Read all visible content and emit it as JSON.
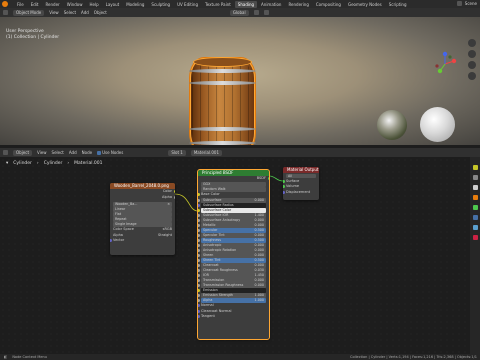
{
  "topbar": {
    "workspaces": [
      "File",
      "Edit",
      "Render",
      "Window",
      "Help",
      "Layout",
      "Modeling",
      "Sculpting",
      "UV Editing",
      "Texture Paint",
      "Shading",
      "Animation",
      "Rendering",
      "Compositing",
      "Geometry Nodes",
      "Scripting"
    ],
    "active_workspace": "Shading",
    "scene": "Scene"
  },
  "viewport": {
    "mode": "Object Mode",
    "menu": [
      "View",
      "Select",
      "Add",
      "Object"
    ],
    "transform": "Global",
    "info_line1": "User Perspective",
    "info_line2": "(1) Collection | Cylinder"
  },
  "node_editor": {
    "editor": "Object",
    "menu": [
      "View",
      "Select",
      "Add",
      "Node"
    ],
    "use_nodes_label": "Use Nodes",
    "slot": "Slot 1",
    "material": "Material.001",
    "breadcrumb": [
      "Cylinder",
      "Cylinder",
      "Material.001"
    ]
  },
  "image_node": {
    "title": "Wooden_Barrel_2048.0.png",
    "outputs": [
      "Color",
      "Alpha"
    ],
    "image_name": "Wooden_Ba...",
    "options": [
      "Linear",
      "Flat",
      "Repeat",
      "Single Image"
    ],
    "color_space_label": "Color Space",
    "color_space": "sRGB",
    "alpha_label": "Alpha",
    "alpha": "Straight",
    "vector": "Vector"
  },
  "bsdf_node": {
    "title": "Principled BSDF",
    "output": "BSDF",
    "distribution": "GGX",
    "subsurface_method": "Random Walk",
    "base_color": "Base Color",
    "fields": [
      {
        "label": "Subsurface",
        "value": "0.000"
      },
      {
        "label": "Subsurface Radius",
        "value": ""
      },
      {
        "label": "Subsurface Color",
        "value": ""
      },
      {
        "label": "Subsurface IOR",
        "value": "1.400"
      },
      {
        "label": "Subsurface Anisotropy",
        "value": "0.000"
      },
      {
        "label": "Metallic",
        "value": "0.000"
      },
      {
        "label": "Specular",
        "value": "0.500"
      },
      {
        "label": "Specular Tint",
        "value": "0.000"
      },
      {
        "label": "Roughness",
        "value": "0.500"
      },
      {
        "label": "Anisotropic",
        "value": "0.000"
      },
      {
        "label": "Anisotropic Rotation",
        "value": "0.000"
      },
      {
        "label": "Sheen",
        "value": "0.000"
      },
      {
        "label": "Sheen Tint",
        "value": "0.500"
      },
      {
        "label": "Clearcoat",
        "value": "0.000"
      },
      {
        "label": "Clearcoat Roughness",
        "value": "0.030"
      },
      {
        "label": "IOR",
        "value": "1.450"
      },
      {
        "label": "Transmission",
        "value": "0.000"
      },
      {
        "label": "Transmission Roughness",
        "value": "0.000"
      },
      {
        "label": "Emission",
        "value": ""
      },
      {
        "label": "Emission Strength",
        "value": "1.000"
      },
      {
        "label": "Alpha",
        "value": "1.000"
      }
    ],
    "inputs_tail": [
      "Normal",
      "Clearcoat Normal",
      "Tangent"
    ]
  },
  "output_node": {
    "title": "Material Output",
    "target": "All",
    "inputs": [
      "Surface",
      "Volume",
      "Displacement"
    ]
  },
  "status": {
    "left": "Node Context Menu",
    "right": "Collection | Cylinder | Verts:1,194 | Faces:1,216 | Tris:2,368 | Objects:1/1"
  },
  "colors": {
    "accent": "#e87d0d",
    "image_header": "#8a4a23",
    "bsdf_header": "#2e7d32",
    "output_header": "#7a2a2a",
    "socket_yellow": "#c7c729",
    "socket_grey": "#a1a1a1",
    "socket_purple": "#6363c7",
    "selected_outline": "#ffa733"
  }
}
